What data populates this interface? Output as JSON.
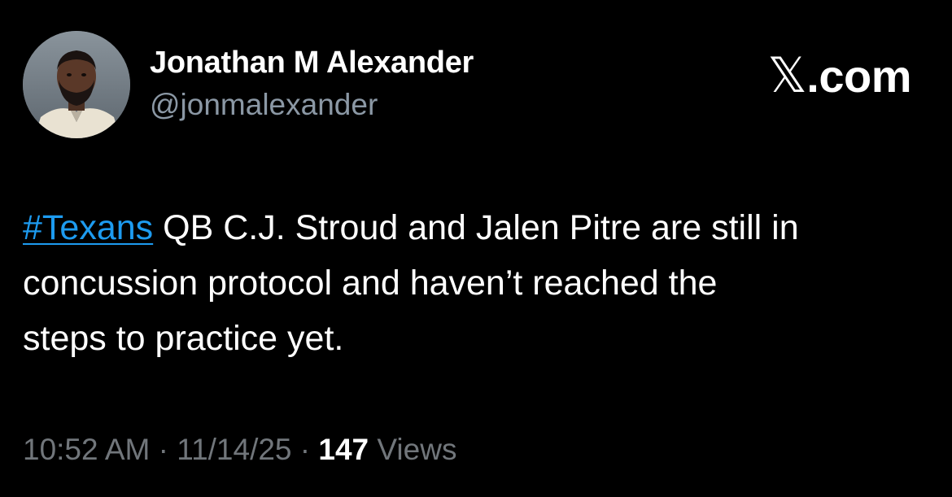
{
  "tweet": {
    "author": {
      "display_name": "Jonathan M Alexander",
      "handle": "@jonmalexander"
    },
    "brand": {
      "x_glyph": "𝕏",
      "suffix": ".com"
    },
    "body": {
      "hashtag": "#Texans",
      "text_line1": " QB C.J. Stroud and Jalen Pitre are still in",
      "text_line2": "concussion protocol and haven’t reached the",
      "text_line3": "steps to practice yet."
    },
    "meta": {
      "time": "10:52 AM",
      "separator1": " · ",
      "date": "11/14/25",
      "separator2": " · ",
      "views_count": "147",
      "views_label": " Views"
    }
  }
}
